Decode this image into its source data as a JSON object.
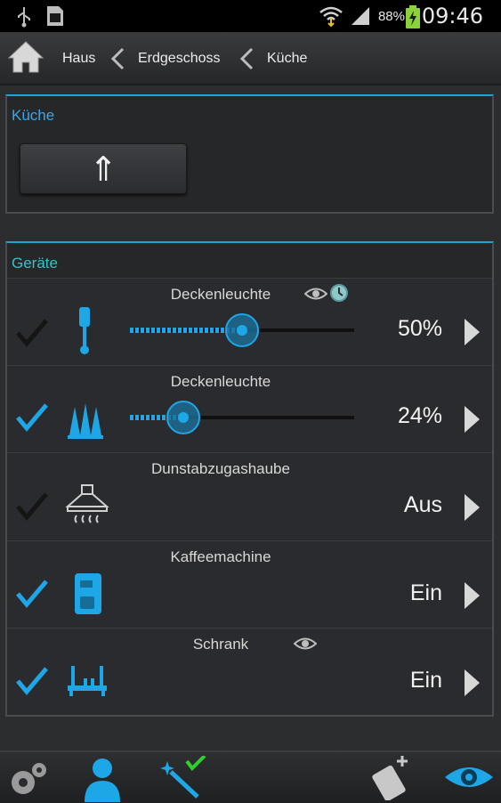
{
  "status_bar": {
    "battery_percent": "88%",
    "time": "09:46",
    "icons": [
      "usb-icon",
      "sd-card-icon",
      "wifi-icon",
      "signal-icon",
      "battery-charging-icon"
    ]
  },
  "breadcrumb": {
    "items": [
      "Haus",
      "Erdgeschoss",
      "Küche"
    ]
  },
  "room_panel": {
    "title": "Küche",
    "up_button_glyph": "⇑"
  },
  "devices_panel": {
    "title": "Geräte",
    "devices": [
      {
        "name": "Deckenleuchte",
        "icon": "ceiling-lamp-icon",
        "checked": false,
        "value": "50%",
        "slider_level": 0.5,
        "flags": [
          "eye-icon",
          "timer-icon"
        ]
      },
      {
        "name": "Deckenleuchte",
        "icon": "multi-lamp-icon",
        "checked": true,
        "value": "24%",
        "slider_level": 0.24,
        "flags": []
      },
      {
        "name": "Dunstabzugashaube",
        "icon": "cooker-hood-icon",
        "checked": false,
        "value": "Aus",
        "flags": []
      },
      {
        "name": "Kaffeemachine",
        "icon": "coffee-machine-icon",
        "checked": true,
        "value": "Ein",
        "flags": []
      },
      {
        "name": "Schrank",
        "icon": "cabinet-icon",
        "checked": true,
        "value": "Ein",
        "flags": [
          "eye-icon"
        ]
      }
    ]
  },
  "bottom_bar": {
    "icons": [
      "settings-icon",
      "user-icon",
      "magic-wand-icon",
      "phone-add-icon",
      "eye-icon"
    ]
  },
  "colors": {
    "accent": "#1da5d8",
    "check_active": "#1ea7e6",
    "check_inactive": "#151515",
    "panel_title_room": "#3aa7e8",
    "panel_title_devices": "#34c3c8"
  }
}
